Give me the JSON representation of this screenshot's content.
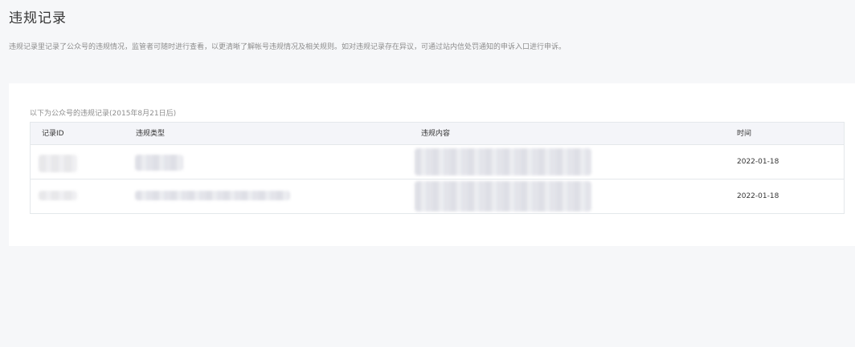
{
  "header": {
    "title": "违规记录",
    "description": "违规记录里记录了公众号的违规情况，监管者可随时进行查看，以更清晰了解帐号违规情况及相关规则。如对违规记录存在异议，可通过站内信处罚通知的申诉入口进行申诉。"
  },
  "table": {
    "caption": "以下为公众号的违规记录(2015年8月21日后)",
    "columns": [
      "记录ID",
      "违规类型",
      "违规内容",
      "时间"
    ],
    "rows": [
      {
        "id": "",
        "type": "",
        "content": "",
        "time": "2022-01-18"
      },
      {
        "id": "",
        "type": "",
        "content": "",
        "time": "2022-01-18"
      }
    ]
  }
}
